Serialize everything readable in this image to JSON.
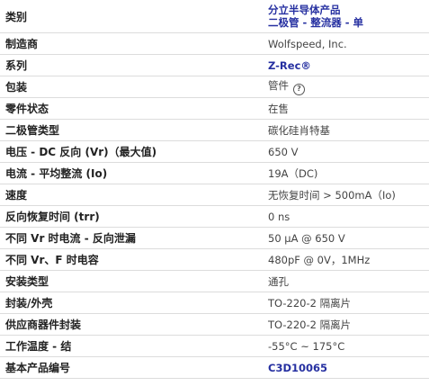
{
  "header": {
    "category_label": "类别",
    "category_line1": "分立半导体产品",
    "category_line2": "二极管 - 整流器 - 单"
  },
  "rows": [
    {
      "label": "制造商",
      "value": "Wolfspeed, Inc."
    },
    {
      "label": "系列",
      "value": "Z-Rec®"
    },
    {
      "label": "包装",
      "value": "管件",
      "help_icon": "question-circle-icon"
    },
    {
      "label": "零件状态",
      "value": "在售"
    },
    {
      "label": "二极管类型",
      "value": "碳化硅肖特基"
    },
    {
      "label": "电压 - DC 反向 (Vr)（最大值)",
      "value": "650 V"
    },
    {
      "label": "电流 - 平均整流 (Io)",
      "value": "19A（DC)"
    },
    {
      "label": "速度",
      "value": "无恢复时间 > 500mA（Io)"
    },
    {
      "label": "反向恢复时间 (trr)",
      "value": "0 ns"
    },
    {
      "label": "不同 Vr 时电流 - 反向泄漏",
      "value": "50 µA @ 650 V"
    },
    {
      "label": "不同 Vr、F 时电容",
      "value": "480pF @ 0V，1MHz"
    },
    {
      "label": "安装类型",
      "value": "通孔"
    },
    {
      "label": "封装/外壳",
      "value": "TO-220-2 隔离片"
    },
    {
      "label": "供应商器件封装",
      "value": "TO-220-2 隔离片"
    },
    {
      "label": "工作温度 - 结",
      "value": "-55°C ~ 175°C"
    },
    {
      "label": "基本产品编号",
      "value": "C3D10065"
    }
  ],
  "colors": {
    "link": "#2630a1",
    "border": "#dcdcdc"
  }
}
